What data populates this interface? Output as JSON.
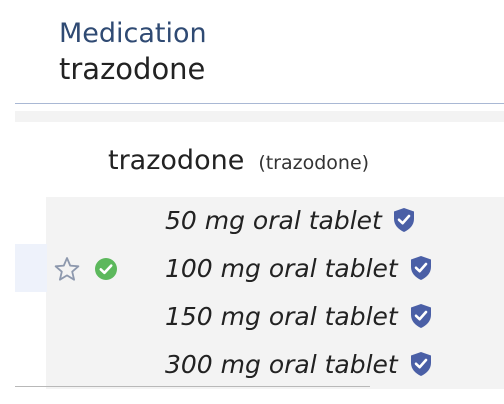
{
  "header": {
    "label": "Medication",
    "value": "trazodone"
  },
  "drug": {
    "name": "trazodone",
    "generic": "(trazodone)"
  },
  "strengths": [
    {
      "label": "50 mg oral tablet",
      "badge_icon": "shield-check-icon"
    },
    {
      "label": "100 mg oral tablet",
      "badge_icon": "shield-check-icon"
    },
    {
      "label": "150 mg oral tablet",
      "badge_icon": "shield-check-icon"
    },
    {
      "label": "300 mg oral tablet",
      "badge_icon": "shield-check-icon"
    }
  ],
  "row_icons": {
    "favorite": "star-outline-icon",
    "status": "green-check-icon"
  },
  "colors": {
    "header_label": "#2f4a73",
    "shield": "#4a5fa6",
    "check": "#5cb85c",
    "star": "#8d98ad"
  }
}
